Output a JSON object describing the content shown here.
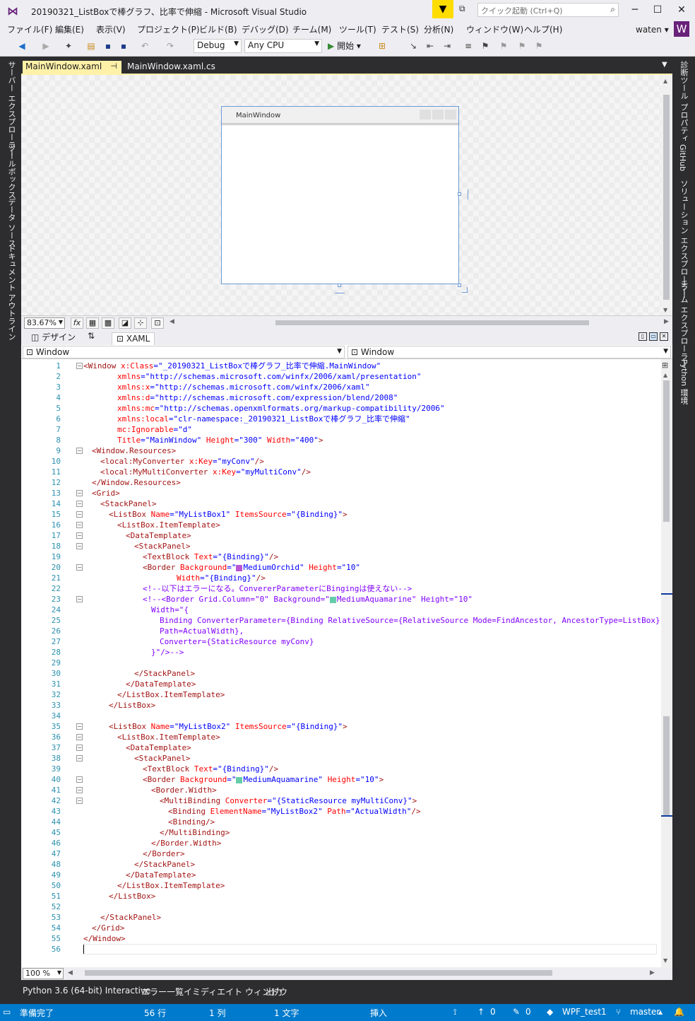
{
  "title": "20190321_ListBoxで棒グラフ、比率で伸縮 - Microsoft Visual Studio",
  "quick_launch": {
    "placeholder": "クイック起動 (Ctrl+Q)"
  },
  "menu": [
    "ファイル(F)",
    "編集(E)",
    "表示(V)",
    "プロジェクト(P)",
    "ビルド(B)",
    "デバッグ(D)",
    "チーム(M)",
    "ツール(T)",
    "テスト(S)",
    "分析(N)",
    "ウィンドウ(W)",
    "ヘルプ(H)"
  ],
  "user": {
    "name": "waten",
    "avatar": "W"
  },
  "toolbar": {
    "config": "Debug",
    "platform": "Any CPU",
    "start": "開始"
  },
  "left_tabs": [
    "サーバー エクスプローラー",
    "ツールボックス",
    "データ ソース",
    "ドキュメント アウトライン"
  ],
  "right_tabs": [
    "診断ツール",
    "プロパティ",
    "GitHub",
    "ソリューション エクスプローラー",
    "チーム エクスプローラー",
    "Python 環境"
  ],
  "doc_tabs": [
    {
      "label": "MainWindow.xaml",
      "active": true
    },
    {
      "label": "MainWindow.xaml.cs",
      "active": false
    }
  ],
  "designer": {
    "window_title": "MainWindow",
    "zoom": "83.67%",
    "fx": "fx"
  },
  "split": {
    "design": "デザイン",
    "xaml": "XAML"
  },
  "nav": {
    "left": "Window",
    "right": "Window"
  },
  "editor_zoom": "100 %",
  "lines": [
    {
      "n": "1",
      "f": "-",
      "i": 0,
      "s": [
        [
          "tg",
          "<Window "
        ],
        [
          "at",
          "x:Class"
        ],
        [
          "vl",
          "=\"_20190321_ListBoxで棒グラフ_比率で伸縮.MainWindow\""
        ]
      ]
    },
    {
      "n": "2",
      "f": "",
      "i": 8,
      "s": [
        [
          "at",
          "xmlns"
        ],
        [
          "vl",
          "=\"http://schemas.microsoft.com/winfx/2006/xaml/presentation\""
        ]
      ]
    },
    {
      "n": "3",
      "f": "",
      "i": 8,
      "s": [
        [
          "at",
          "xmlns:x"
        ],
        [
          "vl",
          "=\"http://schemas.microsoft.com/winfx/2006/xaml\""
        ]
      ]
    },
    {
      "n": "4",
      "f": "",
      "i": 8,
      "s": [
        [
          "at",
          "xmlns:d"
        ],
        [
          "vl",
          "=\"http://schemas.microsoft.com/expression/blend/2008\""
        ]
      ]
    },
    {
      "n": "5",
      "f": "",
      "i": 8,
      "s": [
        [
          "at",
          "xmlns:mc"
        ],
        [
          "vl",
          "=\"http://schemas.openxmlformats.org/markup-compatibility/2006\""
        ]
      ]
    },
    {
      "n": "6",
      "f": "",
      "i": 8,
      "s": [
        [
          "at",
          "xmlns:local"
        ],
        [
          "vl",
          "=\"clr-namespace:_20190321_ListBoxで棒グラフ_比率で伸縮\""
        ]
      ]
    },
    {
      "n": "7",
      "f": "",
      "i": 8,
      "s": [
        [
          "at",
          "mc:Ignorable"
        ],
        [
          "vl",
          "=\"d\""
        ]
      ]
    },
    {
      "n": "8",
      "f": "",
      "i": 8,
      "s": [
        [
          "at",
          "Title"
        ],
        [
          "vl",
          "=\"MainWindow\" "
        ],
        [
          "at",
          "Height"
        ],
        [
          "vl",
          "=\"300\" "
        ],
        [
          "at",
          "Width"
        ],
        [
          "vl",
          "=\"400\""
        ],
        [
          "tg",
          ">"
        ]
      ]
    },
    {
      "n": "9",
      "f": "-",
      "i": 2,
      "s": [
        [
          "tg",
          "<Window.Resources>"
        ]
      ]
    },
    {
      "n": "10",
      "f": "",
      "i": 4,
      "s": [
        [
          "tg",
          "<local:MyConverter "
        ],
        [
          "at",
          "x:Key"
        ],
        [
          "vl",
          "=\"myConv\""
        ],
        [
          "tg",
          "/>"
        ]
      ]
    },
    {
      "n": "11",
      "f": "",
      "i": 4,
      "s": [
        [
          "tg",
          "<local:MyMultiConverter "
        ],
        [
          "at",
          "x:Key"
        ],
        [
          "vl",
          "=\"myMultiConv\""
        ],
        [
          "tg",
          "/>"
        ]
      ]
    },
    {
      "n": "12",
      "f": "",
      "i": 2,
      "s": [
        [
          "tg",
          "</Window.Resources>"
        ]
      ]
    },
    {
      "n": "13",
      "f": "-",
      "i": 2,
      "s": [
        [
          "tg",
          "<Grid>"
        ]
      ]
    },
    {
      "n": "14",
      "f": "-",
      "i": 4,
      "s": [
        [
          "tg",
          "<StackPanel>"
        ]
      ]
    },
    {
      "n": "15",
      "f": "-",
      "i": 6,
      "s": [
        [
          "tg",
          "<ListBox "
        ],
        [
          "at",
          "Name"
        ],
        [
          "vl",
          "=\"MyListBox1\" "
        ],
        [
          "at",
          "ItemsSource"
        ],
        [
          "vl",
          "=\"{Binding}\""
        ],
        [
          "tg",
          ">"
        ]
      ]
    },
    {
      "n": "16",
      "f": "-",
      "i": 8,
      "s": [
        [
          "tg",
          "<ListBox.ItemTemplate>"
        ]
      ]
    },
    {
      "n": "17",
      "f": "-",
      "i": 10,
      "s": [
        [
          "tg",
          "<DataTemplate>"
        ]
      ]
    },
    {
      "n": "18",
      "f": "-",
      "i": 12,
      "s": [
        [
          "tg",
          "<StackPanel>"
        ]
      ]
    },
    {
      "n": "19",
      "f": "",
      "i": 14,
      "s": [
        [
          "tg",
          "<TextBlock "
        ],
        [
          "at",
          "Text"
        ],
        [
          "vl",
          "=\"{Binding}\""
        ],
        [
          "tg",
          "/>"
        ]
      ]
    },
    {
      "n": "20",
      "f": "-",
      "i": 14,
      "s": [
        [
          "tg",
          "<Border "
        ],
        [
          "at",
          "Background"
        ],
        [
          "vl",
          "=\""
        ],
        [
          "sw",
          "#ba55d3"
        ],
        [
          "vl",
          "MediumOrchid\" "
        ],
        [
          "at",
          "Height"
        ],
        [
          "vl",
          "=\"10\""
        ]
      ]
    },
    {
      "n": "21",
      "f": "",
      "i": 22,
      "s": [
        [
          "at",
          "Width"
        ],
        [
          "vl",
          "=\"{Binding}\""
        ],
        [
          "tg",
          "/>"
        ]
      ]
    },
    {
      "n": "22",
      "f": "",
      "i": 14,
      "s": [
        [
          "cm",
          "<!--以下はエラーになる。ConvererParameterにBingingは使えない-->"
        ]
      ]
    },
    {
      "n": "23",
      "f": "-",
      "i": 14,
      "s": [
        [
          "cm",
          "<!--<Border Grid.Column=\"0\" Background=\""
        ],
        [
          "sw",
          "#66cdaa"
        ],
        [
          "cm",
          "MediumAquamarine\" Height=\"10\""
        ]
      ]
    },
    {
      "n": "24",
      "f": "",
      "i": 16,
      "s": [
        [
          "cm",
          "Width=\"{"
        ]
      ]
    },
    {
      "n": "25",
      "f": "",
      "i": 18,
      "s": [
        [
          "cm",
          "Binding ConverterParameter={Binding RelativeSource={RelativeSource Mode=FindAncestor, AncestorType=ListBox},"
        ]
      ]
    },
    {
      "n": "26",
      "f": "",
      "i": 18,
      "s": [
        [
          "cm",
          "Path=ActualWidth},"
        ]
      ]
    },
    {
      "n": "27",
      "f": "",
      "i": 18,
      "s": [
        [
          "cm",
          "Converter={StaticResource myConv}"
        ]
      ]
    },
    {
      "n": "28",
      "f": "",
      "i": 16,
      "s": [
        [
          "cm",
          "}\"/>-->"
        ]
      ]
    },
    {
      "n": "29",
      "f": "",
      "i": 0,
      "s": []
    },
    {
      "n": "30",
      "f": "",
      "i": 12,
      "s": [
        [
          "tg",
          "</StackPanel>"
        ]
      ]
    },
    {
      "n": "31",
      "f": "",
      "i": 10,
      "s": [
        [
          "tg",
          "</DataTemplate>"
        ]
      ]
    },
    {
      "n": "32",
      "f": "",
      "i": 8,
      "s": [
        [
          "tg",
          "</ListBox.ItemTemplate>"
        ]
      ]
    },
    {
      "n": "33",
      "f": "",
      "i": 6,
      "s": [
        [
          "tg",
          "</ListBox>"
        ]
      ]
    },
    {
      "n": "34",
      "f": "",
      "i": 0,
      "s": []
    },
    {
      "n": "35",
      "f": "-",
      "i": 6,
      "s": [
        [
          "tg",
          "<ListBox "
        ],
        [
          "at",
          "Name"
        ],
        [
          "vl",
          "=\"MyListBox2\" "
        ],
        [
          "at",
          "ItemsSource"
        ],
        [
          "vl",
          "=\"{Binding}\""
        ],
        [
          "tg",
          ">"
        ]
      ]
    },
    {
      "n": "36",
      "f": "-",
      "i": 8,
      "s": [
        [
          "tg",
          "<ListBox.ItemTemplate>"
        ]
      ]
    },
    {
      "n": "37",
      "f": "-",
      "i": 10,
      "s": [
        [
          "tg",
          "<DataTemplate>"
        ]
      ]
    },
    {
      "n": "38",
      "f": "-",
      "i": 12,
      "s": [
        [
          "tg",
          "<StackPanel>"
        ]
      ]
    },
    {
      "n": "39",
      "f": "",
      "i": 14,
      "s": [
        [
          "tg",
          "<TextBlock "
        ],
        [
          "at",
          "Text"
        ],
        [
          "vl",
          "=\"{Binding}\""
        ],
        [
          "tg",
          "/>"
        ]
      ]
    },
    {
      "n": "40",
      "f": "-",
      "i": 14,
      "s": [
        [
          "tg",
          "<Border "
        ],
        [
          "at",
          "Background"
        ],
        [
          "vl",
          "=\""
        ],
        [
          "sw",
          "#66cdaa"
        ],
        [
          "vl",
          "MediumAquamarine\" "
        ],
        [
          "at",
          "Height"
        ],
        [
          "vl",
          "=\"10\""
        ],
        [
          "tg",
          ">"
        ]
      ]
    },
    {
      "n": "41",
      "f": "-",
      "i": 16,
      "s": [
        [
          "tg",
          "<Border.Width>"
        ]
      ]
    },
    {
      "n": "42",
      "f": "-",
      "i": 18,
      "s": [
        [
          "tg",
          "<MultiBinding "
        ],
        [
          "at",
          "Converter"
        ],
        [
          "vl",
          "=\"{StaticResource myMultiConv}\""
        ],
        [
          "tg",
          ">"
        ]
      ]
    },
    {
      "n": "43",
      "f": "",
      "i": 20,
      "s": [
        [
          "tg",
          "<Binding "
        ],
        [
          "at",
          "ElementName"
        ],
        [
          "vl",
          "=\"MyListBox2\" "
        ],
        [
          "at",
          "Path"
        ],
        [
          "vl",
          "=\"ActualWidth\""
        ],
        [
          "tg",
          "/>"
        ]
      ]
    },
    {
      "n": "44",
      "f": "",
      "i": 20,
      "s": [
        [
          "tg",
          "<Binding/>"
        ]
      ]
    },
    {
      "n": "45",
      "f": "",
      "i": 18,
      "s": [
        [
          "tg",
          "</MultiBinding>"
        ]
      ]
    },
    {
      "n": "46",
      "f": "",
      "i": 16,
      "s": [
        [
          "tg",
          "</Border.Width>"
        ]
      ]
    },
    {
      "n": "47",
      "f": "",
      "i": 14,
      "s": [
        [
          "tg",
          "</Border>"
        ]
      ]
    },
    {
      "n": "48",
      "f": "",
      "i": 12,
      "s": [
        [
          "tg",
          "</StackPanel>"
        ]
      ]
    },
    {
      "n": "49",
      "f": "",
      "i": 10,
      "s": [
        [
          "tg",
          "</DataTemplate>"
        ]
      ]
    },
    {
      "n": "50",
      "f": "",
      "i": 8,
      "s": [
        [
          "tg",
          "</ListBox.ItemTemplate>"
        ]
      ]
    },
    {
      "n": "51",
      "f": "",
      "i": 6,
      "s": [
        [
          "tg",
          "</ListBox>"
        ]
      ]
    },
    {
      "n": "52",
      "f": "",
      "i": 0,
      "s": []
    },
    {
      "n": "53",
      "f": "",
      "i": 4,
      "s": [
        [
          "tg",
          "</StackPanel>"
        ]
      ]
    },
    {
      "n": "54",
      "f": "",
      "i": 2,
      "s": [
        [
          "tg",
          "</Grid>"
        ]
      ]
    },
    {
      "n": "55",
      "f": "",
      "i": 0,
      "s": [
        [
          "tg",
          "</Window>"
        ]
      ]
    },
    {
      "n": "56",
      "f": "",
      "i": 0,
      "s": []
    }
  ],
  "bottom_tabs": [
    "Python 3.6 (64-bit) Interactive",
    "エラー一覧",
    "イミディエイト ウィンドウ",
    "出力"
  ],
  "status": {
    "ready": "準備完了",
    "line": "56 行",
    "col": "1 列",
    "chars": "1 文字",
    "mode": "挿入",
    "up": "0",
    "edits": "0",
    "repo": "WPF_test1",
    "branch": "master"
  }
}
